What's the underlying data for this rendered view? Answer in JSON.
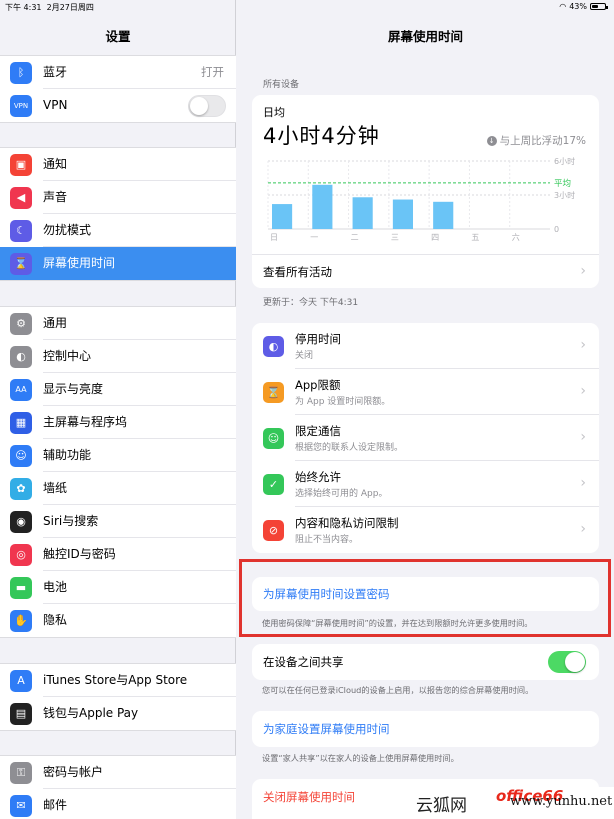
{
  "status": {
    "time": "下午 4:31",
    "date": "2月27日周四",
    "battery": "43%",
    "battery_level": 0.43
  },
  "sidebar": {
    "title": "设置",
    "group1": [
      {
        "label": "蓝牙",
        "value": "打开",
        "icon": "bluetooth-icon",
        "color": "#2f7cf6"
      },
      {
        "label": "VPN",
        "toggle": false,
        "icon": "vpn-icon",
        "color": "#2f7cf6"
      }
    ],
    "group2": [
      {
        "label": "通知",
        "icon": "notifications-icon",
        "color": "#f44336"
      },
      {
        "label": "声音",
        "icon": "sound-icon",
        "color": "#f0364f"
      },
      {
        "label": "勿扰模式",
        "icon": "moon-icon",
        "color": "#5e5ce6"
      },
      {
        "label": "屏幕使用时间",
        "icon": "hourglass-icon",
        "color": "#5e5ce6",
        "selected": true
      }
    ],
    "group3": [
      {
        "label": "通用",
        "icon": "gear-icon",
        "color": "#8e8e93"
      },
      {
        "label": "控制中心",
        "icon": "switches-icon",
        "color": "#8e8e93"
      },
      {
        "label": "显示与亮度",
        "icon": "display-icon",
        "color": "#2f7cf6"
      },
      {
        "label": "主屏幕与程序坞",
        "icon": "homescreen-icon",
        "color": "#2f5fe6"
      },
      {
        "label": "辅助功能",
        "icon": "accessibility-icon",
        "color": "#2f7cf6"
      },
      {
        "label": "墙纸",
        "icon": "wallpaper-icon",
        "color": "#32ade6"
      },
      {
        "label": "Siri与搜索",
        "icon": "siri-icon",
        "color": "#222222"
      },
      {
        "label": "触控ID与密码",
        "icon": "fingerprint-icon",
        "color": "#f0364f"
      },
      {
        "label": "电池",
        "icon": "battery-icon",
        "color": "#34c759"
      },
      {
        "label": "隐私",
        "icon": "hand-icon",
        "color": "#2f7cf6"
      }
    ],
    "group4": [
      {
        "label": "iTunes Store与App Store",
        "icon": "appstore-icon",
        "color": "#2f7cf6"
      },
      {
        "label": "钱包与Apple Pay",
        "icon": "wallet-icon",
        "color": "#222222"
      }
    ],
    "group5": [
      {
        "label": "密码与帐户",
        "icon": "key-icon",
        "color": "#8e8e93"
      },
      {
        "label": "邮件",
        "icon": "mail-icon",
        "color": "#2f7cf6"
      }
    ]
  },
  "main": {
    "title": "屏幕使用时间",
    "all_devices": "所有设备",
    "daily_label": "日均",
    "daily_value": "4小时4分钟",
    "compare": "与上周比浮动17%",
    "see_all": "查看所有活动",
    "updated": "更新于：今天 下午4:31",
    "features": [
      {
        "title": "停用时间",
        "sub": "关闭",
        "icon": "downtime-icon",
        "color": "#5e5ce6"
      },
      {
        "title": "App限额",
        "sub": "为 App 设置时间限额。",
        "icon": "hourglass-icon",
        "color": "#f59a23"
      },
      {
        "title": "限定通信",
        "sub": "根据您的联系人设定限制。",
        "icon": "contacts-icon",
        "color": "#34c759"
      },
      {
        "title": "始终允许",
        "sub": "选择始终可用的 App。",
        "icon": "checkmark-icon",
        "color": "#34c759"
      },
      {
        "title": "内容和隐私访问限制",
        "sub": "阻止不当内容。",
        "icon": "restrict-icon",
        "color": "#f44336"
      }
    ],
    "passcode": "为屏幕使用时间设置密码",
    "passcode_note": "使用密码保障“屏幕使用时间”的设置，并在达到限额时允许更多使用时间。",
    "share": "在设备之间共享",
    "share_on": true,
    "share_note": "您可以在任何已登录iCloud的设备上启用，以报告您的综合屏幕使用时间。",
    "family": "为家庭设置屏幕使用时间",
    "family_note": "设置“家人共享”以在家人的设备上使用屏幕使用时间。",
    "turn_off": "关闭屏幕使用时间"
  },
  "chart_data": {
    "type": "bar",
    "categories": [
      "日",
      "一",
      "二",
      "三",
      "四",
      "五",
      "六"
    ],
    "values": [
      2.2,
      3.9,
      2.8,
      2.6,
      2.4,
      0,
      0
    ],
    "average": 4.07,
    "average_label": "平均",
    "ylim": [
      0,
      6
    ],
    "yticks": [
      {
        "v": 6,
        "label": "6小时"
      },
      {
        "v": 3,
        "label": "3小时"
      },
      {
        "v": 0,
        "label": "0"
      }
    ],
    "bar_color": "#6ac4f6",
    "average_color": "#34c759"
  },
  "watermark": {
    "a": "云狐网",
    "b": "office66",
    "c": "www.yunhu.net"
  }
}
